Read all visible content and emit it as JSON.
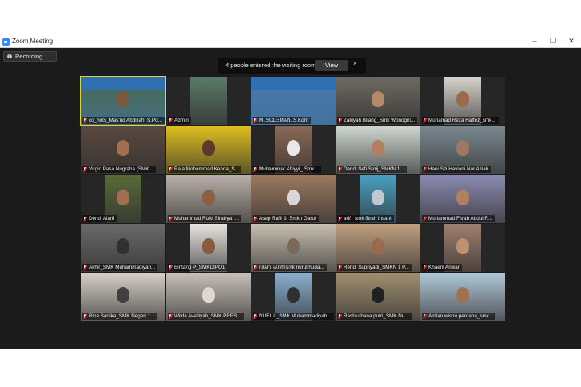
{
  "window": {
    "title": "Zoom Meeting",
    "minimize": "–",
    "maximize": "❐",
    "close": "✕"
  },
  "recording": {
    "label": "Recording..."
  },
  "waiting_room": {
    "message": "4 people entered the waiting room",
    "view_label": "View",
    "close_label": "×"
  },
  "participants": [
    {
      "name": "co_hots_Mas'ud Abdillah, S.Pd...",
      "muted": true,
      "active": true,
      "bg": "#3f6f93",
      "video": "#4b6b52",
      "face": "#7a5a3e",
      "banner": true
    },
    {
      "name": "Admin",
      "muted": true,
      "bg": "#2a2a2a",
      "video": "#5a7a68",
      "face": "",
      "banner": false
    },
    {
      "name": "M. SOLEMAN, S.Kom",
      "muted": true,
      "bg": "#3f6f93",
      "video": "#4a7ab0",
      "face": "",
      "banner": true
    },
    {
      "name": "Zakiyah Bilang_Smk Wonogiri...",
      "muted": true,
      "bg": "#2a2a2a",
      "video": "#6e6a62",
      "face": "#b58a6a",
      "banner": false
    },
    {
      "name": "Muhamad Reza Haffez_smk...",
      "muted": true,
      "bg": "#2a2a2a",
      "video": "#d8d4cc",
      "face": "#9a6a4a",
      "banner": false
    },
    {
      "name": "Virgin Pasa Nugraha (SMK...",
      "muted": true,
      "bg": "#2a2a2a",
      "video": "#5a4a40",
      "face": "#a07050",
      "banner": false
    },
    {
      "name": "Raia Mohammad Kenda_S...",
      "muted": true,
      "bg": "#2a2a2a",
      "video": "#e0c020",
      "face": "#5a3a2a",
      "banner": false
    },
    {
      "name": "Muhammad Abiyyi_ Smk...",
      "muted": true,
      "bg": "#2a2a2a",
      "video": "#8a6a55",
      "face": "#e8e8e8",
      "banner": false
    },
    {
      "name": "Dendi Sefi Sirrij_SMKN 1...",
      "muted": true,
      "bg": "#2a2a2a",
      "video": "#d0d8d0",
      "face": "#b08060",
      "banner": false
    },
    {
      "name": "Hani Siti Haviani Nur Aziah",
      "muted": true,
      "bg": "#2a2a2a",
      "video": "#7a8a90",
      "face": "#a07a60",
      "banner": false
    },
    {
      "name": "Dendi Alarif",
      "muted": true,
      "bg": "#2a2a2a",
      "video": "#5a6a3a",
      "face": "#a07050",
      "banner": false
    },
    {
      "name": "Muhammad Rizki Siratrya_...",
      "muted": true,
      "bg": "#2a2a2a",
      "video": "#b8b0a8",
      "face": "#8a6040",
      "banner": false
    },
    {
      "name": "Asep Rafli S_Smkn Garut",
      "muted": true,
      "bg": "#2a2a2a",
      "video": "#9a7a60",
      "face": "#d8d8d8",
      "banner": false
    },
    {
      "name": "arif _smk fitrah insani",
      "muted": true,
      "bg": "#2a2a2a",
      "video": "#4aa0c0",
      "face": "#c0c8d0",
      "banner": false
    },
    {
      "name": "Muhammad Fitrah Abdul R...",
      "muted": true,
      "bg": "#2a2a2a",
      "video": "#8a8ab0",
      "face": "#b08060",
      "banner": false
    },
    {
      "name": "Akhir_SMK Muhammadiyah...",
      "muted": true,
      "bg": "#2a2a2a",
      "video": "#6a6a6a",
      "face": "#303030",
      "banner": false
    },
    {
      "name": "Bintang P_SMKDIPO1",
      "muted": true,
      "bg": "#2a2a2a",
      "video": "#e8e4e0",
      "face": "#8a5a40",
      "banner": false
    },
    {
      "name": "nilam sari@smk nurul huda...",
      "muted": true,
      "bg": "#2a2a2a",
      "video": "#c8c0b0",
      "face": "#7a6a5a",
      "banner": false
    },
    {
      "name": "Rendi Supriyadi_SMKN 1 P...",
      "muted": true,
      "bg": "#2a2a2a",
      "video": "#c0a080",
      "face": "#9a6a4a",
      "banner": false
    },
    {
      "name": "Khaeril Anwar",
      "muted": true,
      "bg": "#2a2a2a",
      "video": "#a08070",
      "face": "#c09070",
      "banner": false
    },
    {
      "name": "Rina Sartika_SMK Negeri 1...",
      "muted": true,
      "bg": "#2a2a2a",
      "video": "#d8d0c8",
      "face": "#404040",
      "banner": false
    },
    {
      "name": "Wilda Awaliyah_SMK PRES...",
      "muted": true,
      "bg": "#2a2a2a",
      "video": "#c8c0b8",
      "face": "#e0d8d0",
      "banner": false
    },
    {
      "name": "NURUL_SMK Muhammadiyah...",
      "muted": true,
      "bg": "#2a2a2a",
      "video": "#8ab0d0",
      "face": "#303030",
      "banner": false
    },
    {
      "name": "Rasbiuthana putri_SMK Nu...",
      "muted": true,
      "bg": "#2a2a2a",
      "video": "#a09070",
      "face": "#202020",
      "banner": false
    },
    {
      "name": "Ardian wisnu perdana_smk...",
      "muted": true,
      "bg": "#2a2a2a",
      "video": "#b0c8d8",
      "face": "#a07050",
      "banner": false
    }
  ]
}
